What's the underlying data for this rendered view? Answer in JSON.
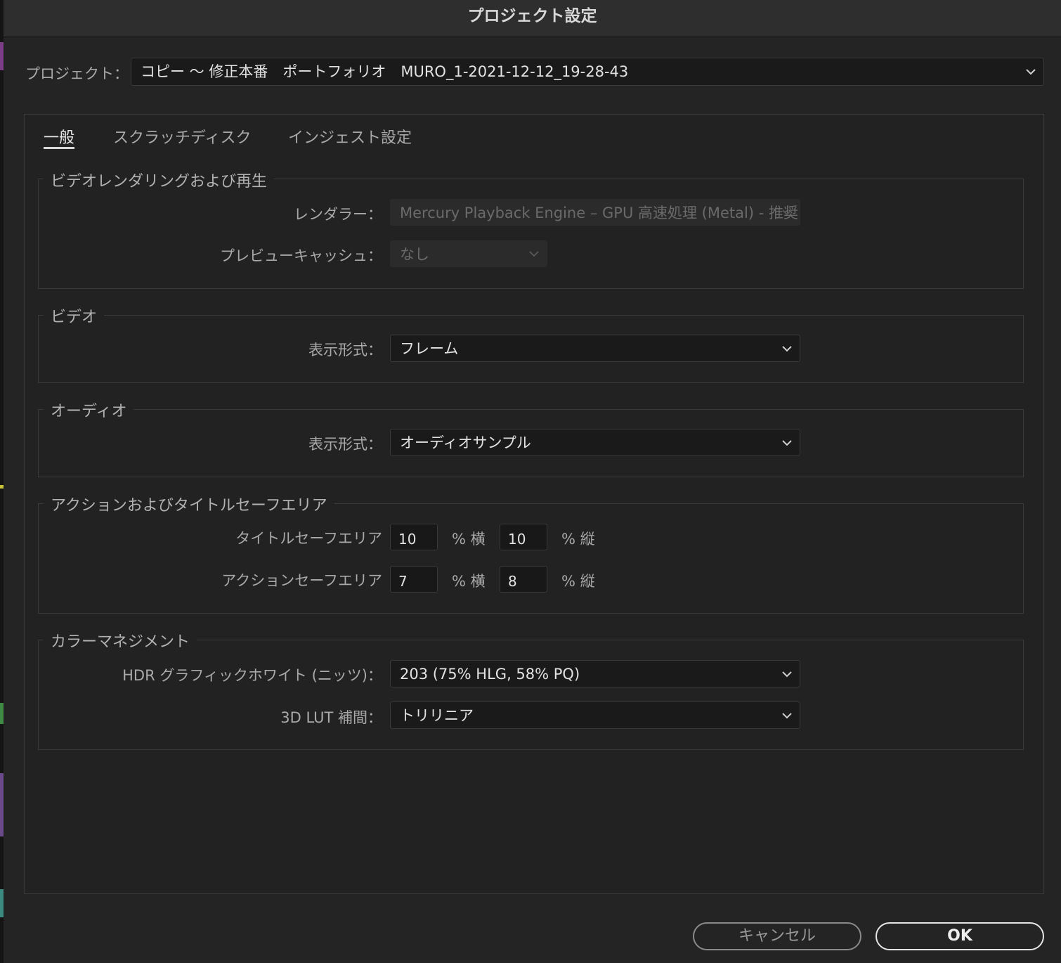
{
  "window": {
    "title": "プロジェクト設定"
  },
  "project": {
    "label": "プロジェクト：",
    "value": "コピー 〜 修正本番　ポートフォリオ　MURO_1-2021-12-12_19-28-43"
  },
  "tabs": [
    {
      "label": "一般",
      "active": true
    },
    {
      "label": "スクラッチディスク",
      "active": false
    },
    {
      "label": "インジェスト設定",
      "active": false
    }
  ],
  "video_rendering": {
    "title": "ビデオレンダリングおよび再生",
    "renderer_label": "レンダラー：",
    "renderer_value": "Mercury Playback Engine – GPU 高速処理 (Metal) - 推奨",
    "preview_cache_label": "プレビューキャッシュ：",
    "preview_cache_value": "なし"
  },
  "video": {
    "title": "ビデオ",
    "display_format_label": "表示形式：",
    "display_format_value": "フレーム"
  },
  "audio": {
    "title": "オーディオ",
    "display_format_label": "表示形式：",
    "display_format_value": "オーディオサンプル"
  },
  "safe_area": {
    "title": "アクションおよびタイトルセーフエリア",
    "title_safe_label": "タイトルセーフエリア",
    "title_safe_h": "10",
    "title_safe_v": "10",
    "action_safe_label": "アクションセーフエリア",
    "action_safe_h": "7",
    "action_safe_v": "8",
    "unit_h": "% 横",
    "unit_v": "% 縦"
  },
  "color_management": {
    "title": "カラーマネジメント",
    "hdr_label": "HDR グラフィックホワイト (ニッツ)：",
    "hdr_value": "203 (75% HLG, 58% PQ)",
    "lut_label": "3D LUT 補間：",
    "lut_value": "トリリニア"
  },
  "buttons": {
    "cancel": "キャンセル",
    "ok": "OK"
  },
  "icons": {
    "dropdown": "chevron-down-icon"
  },
  "colors": {
    "background": "#242424",
    "field": "#1a1a1a",
    "border": "#3a3a3a",
    "text": "#d4d4d4",
    "muted_text": "#a9a9a9",
    "disabled_text": "#6a6a6a"
  }
}
